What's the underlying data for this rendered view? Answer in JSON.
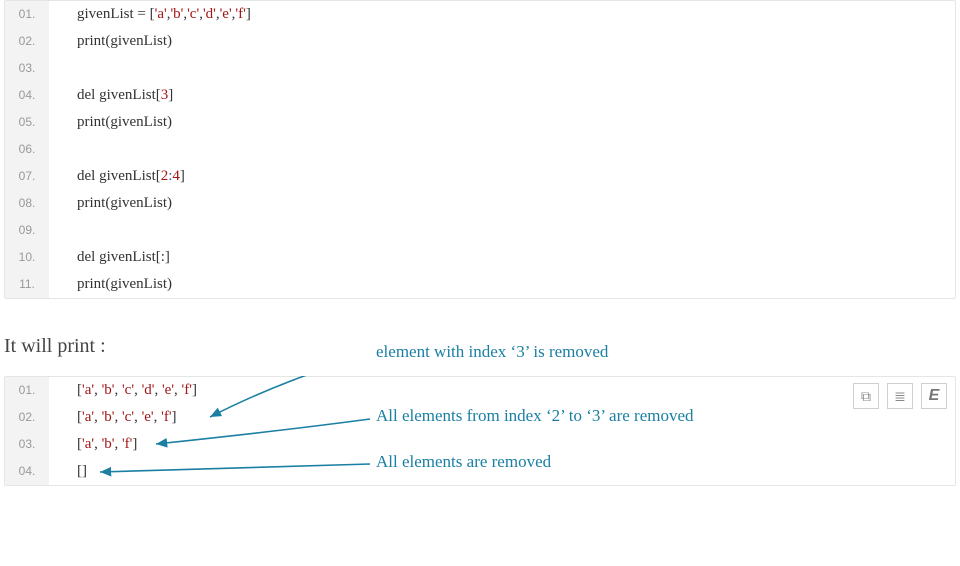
{
  "code_block_1": {
    "lines": [
      {
        "no": "01.",
        "tokens": [
          [
            "p",
            "givenList = ["
          ],
          [
            "s",
            "'a'"
          ],
          [
            "p",
            ","
          ],
          [
            "s",
            "'b'"
          ],
          [
            "p",
            ","
          ],
          [
            "s",
            "'c'"
          ],
          [
            "p",
            ","
          ],
          [
            "s",
            "'d'"
          ],
          [
            "p",
            ","
          ],
          [
            "s",
            "'e'"
          ],
          [
            "p",
            ","
          ],
          [
            "s",
            "'f'"
          ],
          [
            "p",
            "]"
          ]
        ]
      },
      {
        "no": "02.",
        "tokens": [
          [
            "p",
            "print(givenList)"
          ]
        ]
      },
      {
        "no": "03.",
        "tokens": []
      },
      {
        "no": "04.",
        "tokens": [
          [
            "p",
            "del givenList["
          ],
          [
            "n",
            "3"
          ],
          [
            "p",
            "]"
          ]
        ]
      },
      {
        "no": "05.",
        "tokens": [
          [
            "p",
            "print(givenList)"
          ]
        ]
      },
      {
        "no": "06.",
        "tokens": []
      },
      {
        "no": "07.",
        "tokens": [
          [
            "p",
            "del givenList["
          ],
          [
            "n",
            "2"
          ],
          [
            "c",
            ":"
          ],
          [
            "n",
            "4"
          ],
          [
            "p",
            "]"
          ]
        ]
      },
      {
        "no": "08.",
        "tokens": [
          [
            "p",
            "print(givenList)"
          ]
        ]
      },
      {
        "no": "09.",
        "tokens": []
      },
      {
        "no": "10.",
        "tokens": [
          [
            "p",
            "del givenList[:]"
          ]
        ]
      },
      {
        "no": "11.",
        "tokens": [
          [
            "p",
            "print(givenList)"
          ]
        ]
      }
    ]
  },
  "section_label": "It will print :",
  "code_block_2": {
    "lines": [
      {
        "no": "01.",
        "tokens": [
          [
            "p",
            "["
          ],
          [
            "s",
            "'a'"
          ],
          [
            "p",
            ", "
          ],
          [
            "s",
            "'b'"
          ],
          [
            "p",
            ", "
          ],
          [
            "s",
            "'c'"
          ],
          [
            "p",
            ", "
          ],
          [
            "s",
            "'d'"
          ],
          [
            "p",
            ", "
          ],
          [
            "s",
            "'e'"
          ],
          [
            "p",
            ", "
          ],
          [
            "s",
            "'f'"
          ],
          [
            "p",
            "]"
          ]
        ]
      },
      {
        "no": "02.",
        "tokens": [
          [
            "p",
            "["
          ],
          [
            "s",
            "'a'"
          ],
          [
            "p",
            ", "
          ],
          [
            "s",
            "'b'"
          ],
          [
            "p",
            ", "
          ],
          [
            "s",
            "'c'"
          ],
          [
            "p",
            ", "
          ],
          [
            "s",
            "'e'"
          ],
          [
            "p",
            ", "
          ],
          [
            "s",
            "'f'"
          ],
          [
            "p",
            "]"
          ]
        ]
      },
      {
        "no": "03.",
        "tokens": [
          [
            "p",
            "["
          ],
          [
            "s",
            "'a'"
          ],
          [
            "p",
            ", "
          ],
          [
            "s",
            "'b'"
          ],
          [
            "p",
            ", "
          ],
          [
            "s",
            "'f'"
          ],
          [
            "p",
            "]"
          ]
        ]
      },
      {
        "no": "04.",
        "tokens": [
          [
            "p",
            "[]"
          ]
        ]
      }
    ]
  },
  "annotations": {
    "a1": "element with index ‘3’ is removed",
    "a2": "All elements from index ‘2’ to ‘3’ are removed",
    "a3": "All elements are removed"
  },
  "toolbar": {
    "code_icon": "⧉",
    "copy_icon": "≣",
    "e_icon": "E"
  }
}
